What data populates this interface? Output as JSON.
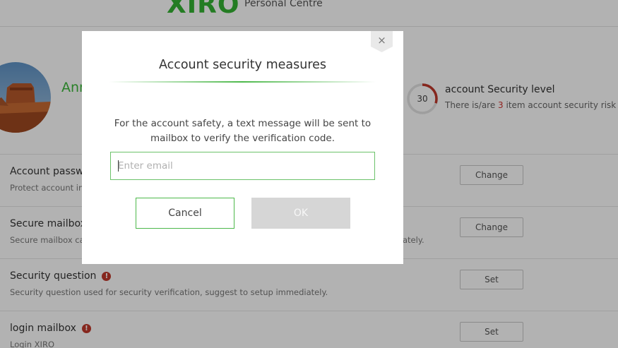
{
  "header": {
    "logo_text": "XIRO",
    "title": "Personal Centre",
    "brand_color": "#34b233"
  },
  "profile": {
    "username": "Ann",
    "security_score": "30",
    "security_score_value": 30,
    "security_title": "account Security level",
    "risk_prefix": "There is/are ",
    "risk_count": "3",
    "risk_suffix": " item account security risk"
  },
  "rows": [
    {
      "title": "Account passw",
      "desc": "Protect account in",
      "button": "Change",
      "warning": false
    },
    {
      "title": "Secure mailbox",
      "desc": "Secure mailbox ca",
      "desc_tail": "ately.",
      "button": "Change",
      "warning": false
    },
    {
      "title": "Security question",
      "desc": "Security question used for security verification, suggest to setup immediately.",
      "button": "Set",
      "warning": true,
      "warning_glyph": "!"
    },
    {
      "title": "login mailbox",
      "desc": "Login XIRO",
      "button": "Set",
      "warning": true,
      "warning_glyph": "!"
    }
  ],
  "dialog": {
    "close_glyph": "×",
    "title": "Account security measures",
    "message": "For the account safety, a text message will be sent to mailbox to verify the verification code.",
    "email_placeholder": "Enter email",
    "email_value": "",
    "cancel_label": "Cancel",
    "ok_label": "OK",
    "accent_color": "#4cb84a",
    "ok_disabled_color": "#d6d6d6"
  },
  "icons": {
    "close": "close-icon",
    "warning": "warning-icon",
    "avatar": "avatar-image"
  }
}
